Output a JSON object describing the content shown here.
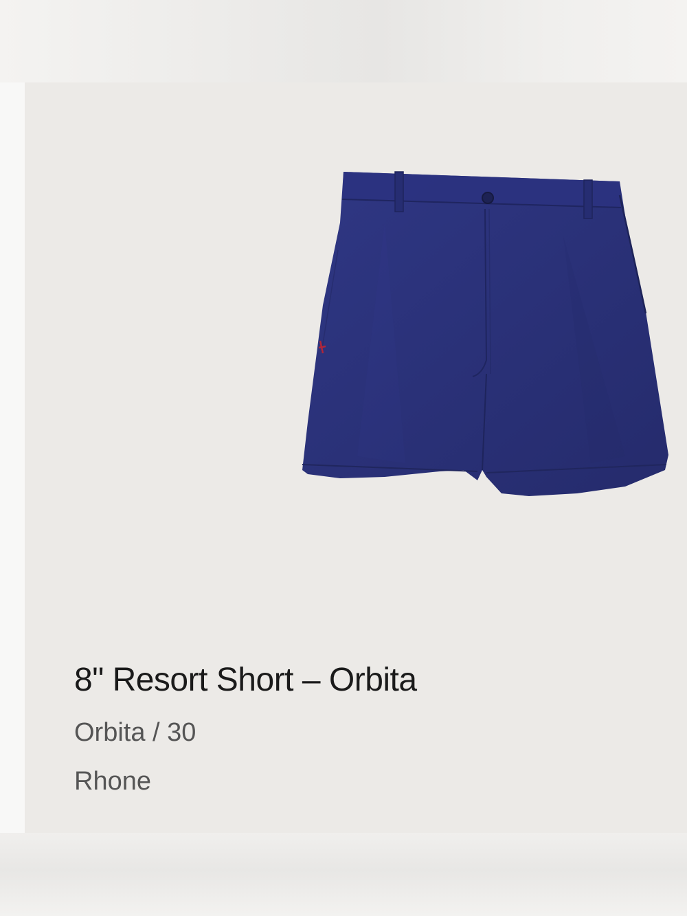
{
  "product": {
    "title": "8\" Resort Short – Orbita",
    "variant": "Orbita / 30",
    "brand": "Rhone",
    "image": {
      "icon": "shorts-image",
      "color": "#2a3178",
      "accent_color": "#b0263a"
    }
  },
  "colors": {
    "background": "#eceae7",
    "title_text": "#1a1a1a",
    "secondary_text": "#555555"
  }
}
